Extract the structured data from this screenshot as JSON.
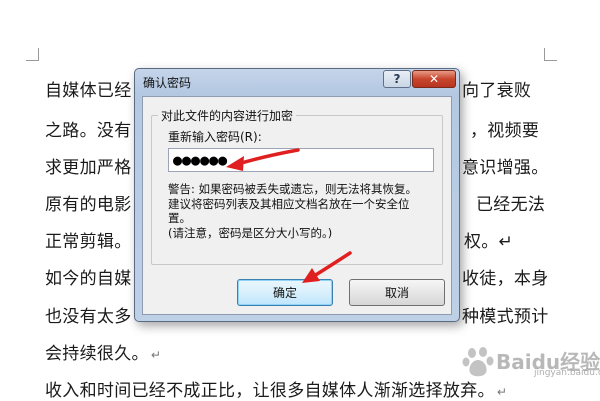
{
  "document": {
    "left_lines": [
      "自媒体已经",
      "之路。没有",
      "求更加严格",
      "原有的电影",
      "正常剪辑。",
      "如今的自媒",
      "也没有太多",
      "会持续很久。"
    ],
    "right_fragments": [
      "向了衰败",
      "，视频要",
      "意识增强。",
      "已经无法",
      "权。",
      "收徒，本身",
      "种模式预计"
    ],
    "full_line": "收入和时间已经不成正比，让很多自媒体人渐渐选择放弃。",
    "paragraph_mark": "↵"
  },
  "dialog": {
    "title": "确认密码",
    "help_button": "?",
    "close_button": "✕",
    "group_title": "对此文件的内容进行加密",
    "field_label": "重新输入密码(R):",
    "password_value": "●●●●●●",
    "warning_lines": [
      "警告: 如果密码被丢失或遗忘，则无法将其恢复。",
      "建议将密码列表及其相应文档名放在一个安全位",
      "置。",
      "(请注意，密码是区分大小写的。)"
    ],
    "ok_button": "确定",
    "cancel_button": "取消"
  },
  "annotations": {
    "arrow_color": "#e02020"
  },
  "watermark": {
    "brand": "Baidu经验",
    "url": "jingyan.baidu.com"
  }
}
